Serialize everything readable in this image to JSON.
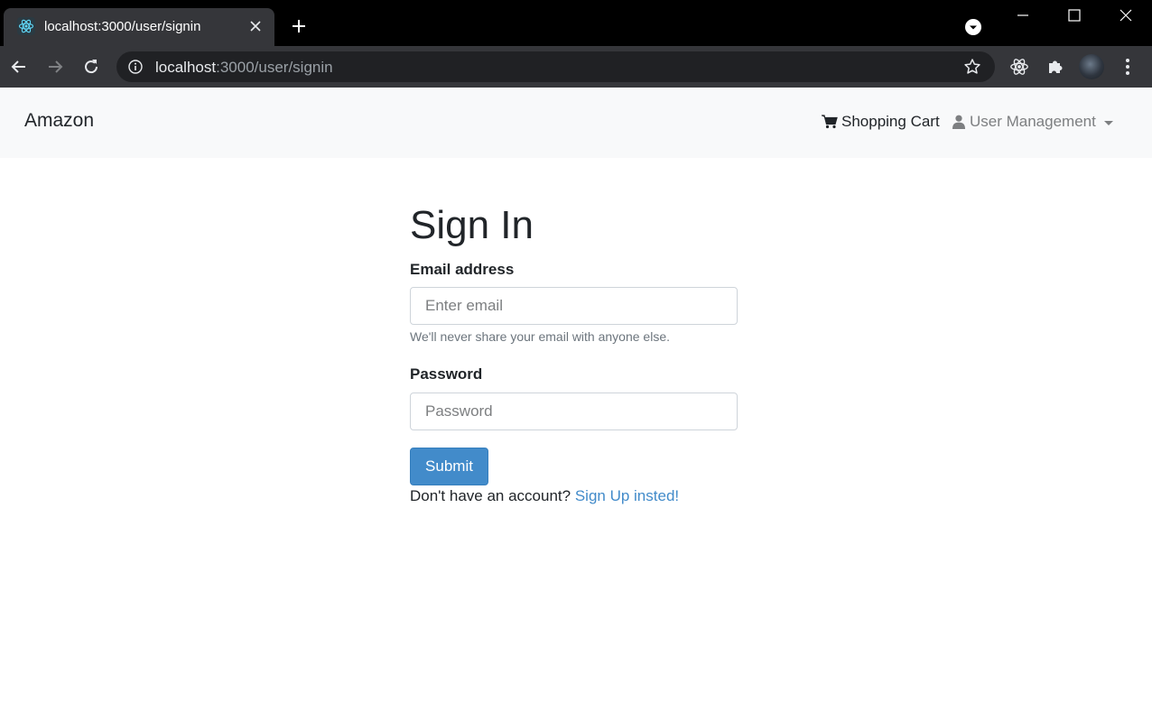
{
  "browser": {
    "tab": {
      "title": "localhost:3000/user/signin",
      "favicon": "react-icon"
    },
    "address_bar": {
      "host": "localhost",
      "path": ":3000/user/signin"
    },
    "colors": {
      "tabbar_bg": "#000000",
      "toolbar_bg": "#35363a",
      "omnibox_bg": "#202124"
    }
  },
  "navbar": {
    "brand": "Amazon",
    "cart_label": "Shopping Cart",
    "cart_icon": "shopping-cart-icon",
    "user_menu_label": "User Management",
    "user_icon": "user-icon"
  },
  "form": {
    "title": "Sign In",
    "email": {
      "label": "Email address",
      "placeholder": "Enter email",
      "value": "",
      "help": "We'll never share your email with anyone else."
    },
    "password": {
      "label": "Password",
      "placeholder": "Password",
      "value": ""
    },
    "submit_label": "Submit",
    "signup_prompt": "Don't have an account?",
    "signup_link": "Sign Up insted!"
  },
  "colors": {
    "primary": "#428bca",
    "navbar_bg": "#f8f9fa",
    "text": "#212529",
    "muted": "#6c757d"
  }
}
